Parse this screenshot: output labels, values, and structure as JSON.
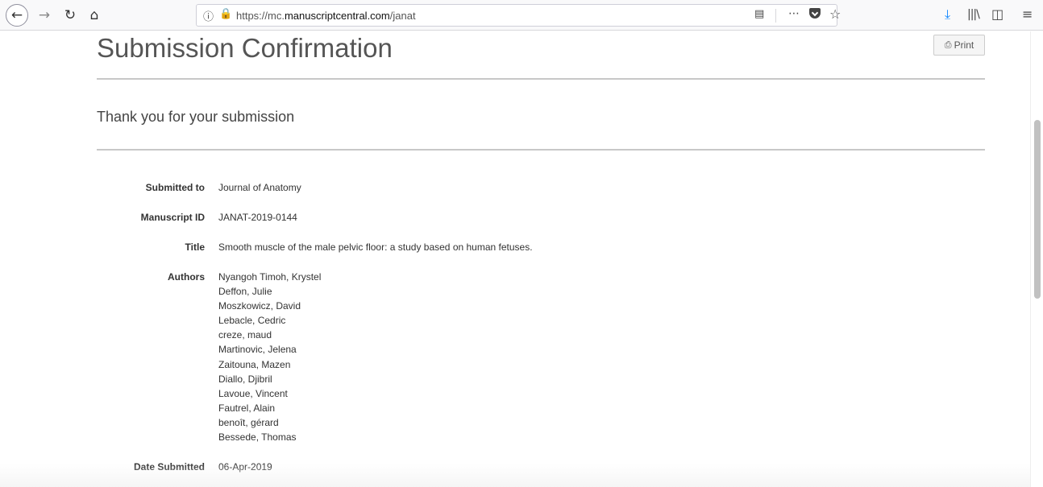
{
  "browser": {
    "url_prefix": "https://mc.",
    "url_domain": "manuscriptcentral.com",
    "url_path": "/janat",
    "icons": {
      "back": "back-arrow-icon",
      "forward": "forward-arrow-icon",
      "reload": "reload-icon",
      "home": "home-icon",
      "info": "info-icon",
      "lock": "lock-icon",
      "reader": "reader-view-icon",
      "more": "page-actions-icon",
      "pocket": "pocket-icon",
      "bookmark": "bookmark-star-icon",
      "download": "download-icon",
      "library": "library-icon",
      "sidebar": "sidebar-icon",
      "menu": "hamburger-menu-icon"
    },
    "colors": {
      "lock": "#12bc00",
      "download": "#0a84ff"
    }
  },
  "page": {
    "title": "Submission Confirmation",
    "print_label": "Print",
    "thanks": "Thank you for your submission"
  },
  "details": {
    "submitted_to": {
      "label": "Submitted to",
      "value": "Journal of Anatomy"
    },
    "manuscript_id": {
      "label": "Manuscript ID",
      "value": "JANAT-2019-0144"
    },
    "title": {
      "label": "Title",
      "value": "Smooth muscle of the male pelvic floor: a study based on human fetuses."
    },
    "authors": {
      "label": "Authors",
      "list": [
        "Nyangoh Timoh, Krystel",
        "Deffon, Julie",
        "Moszkowicz, David",
        "Lebacle, Cedric",
        "creze, maud",
        "Martinovic, Jelena",
        "Zaitouna, Mazen",
        "Diallo, Djibril",
        "Lavoue, Vincent",
        "Fautrel, Alain",
        "benoît, gérard",
        "Bessede, Thomas"
      ]
    },
    "date_submitted": {
      "label": "Date Submitted",
      "value": "06-Apr-2019"
    }
  }
}
